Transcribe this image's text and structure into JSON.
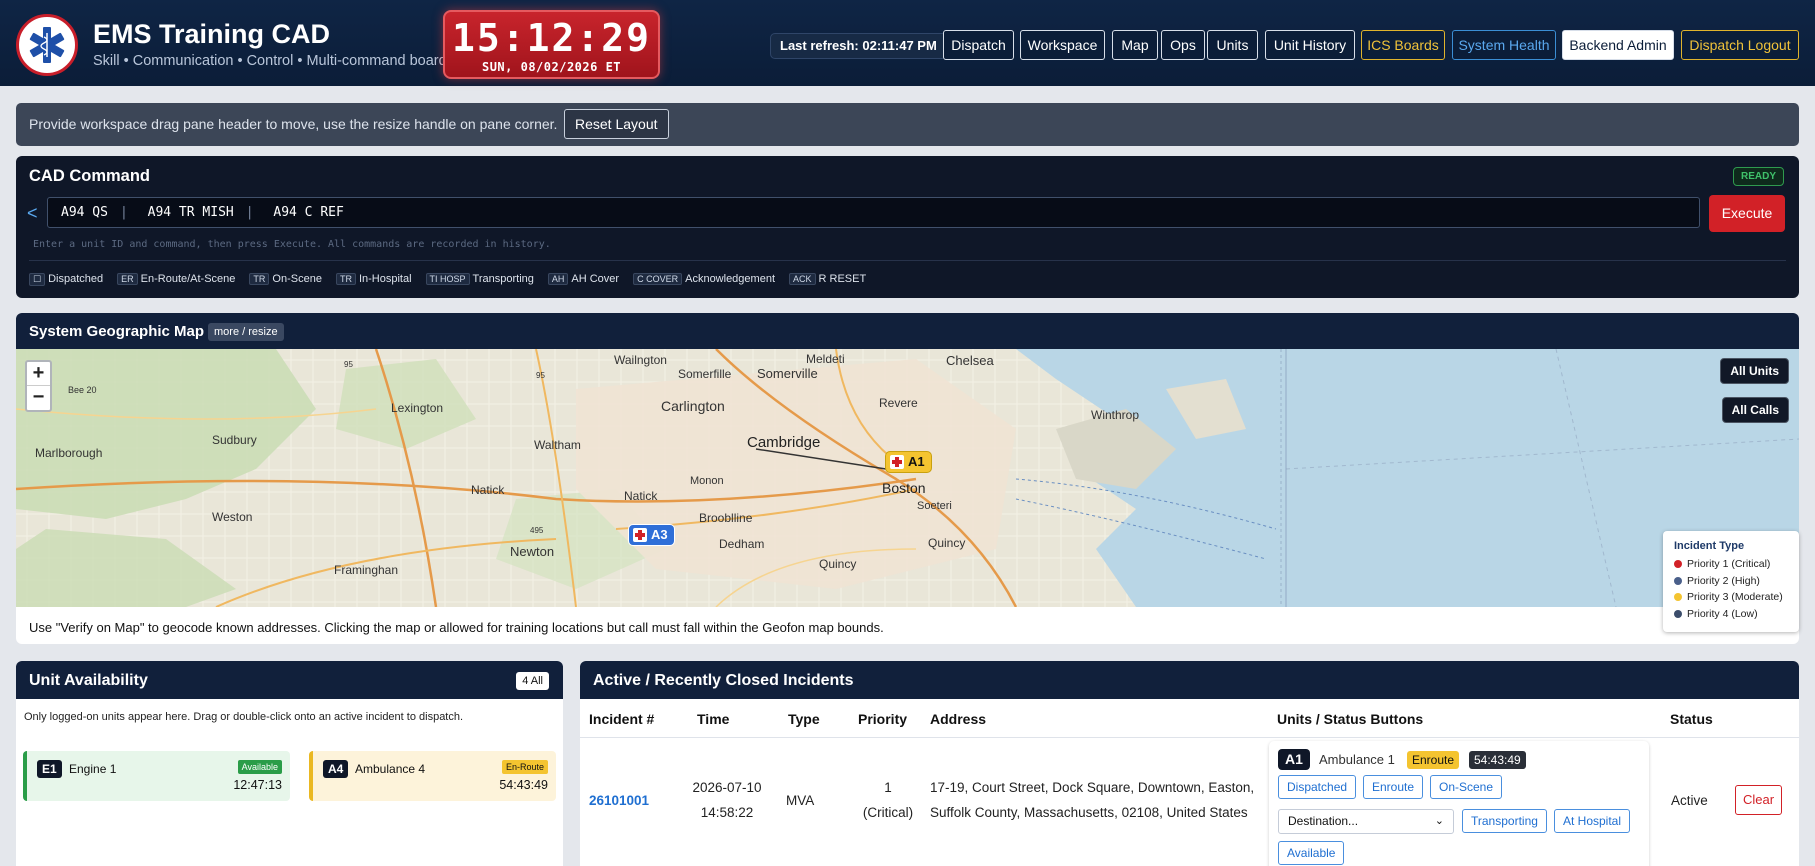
{
  "header": {
    "title": "EMS Training CAD",
    "subtitle": "Skill • Communication • Control • Multi-command board",
    "clock_time": "15:12:29",
    "clock_date": "SUN, 08/02/2026 ET",
    "last_refresh": "Last refresh: 02:11:47 PM",
    "nav": [
      "Dispatch",
      "Workspace",
      "Map",
      "Ops",
      "Units",
      "Unit History",
      "ICS Boards",
      "System Health",
      "Backend Admin",
      "Dispatch Logout"
    ]
  },
  "infobar": {
    "text": "Provide workspace drag pane header to move, use the resize handle on pane corner.",
    "reset_label": "Reset Layout"
  },
  "cad": {
    "title": "CAD Command",
    "ready_badge": "READY",
    "arrow": "<",
    "commands": [
      "A94 QS",
      "A94 TR MISH",
      "A94 C REF"
    ],
    "hint": "Enter a unit ID and command, then press Execute. All commands are recorded in history.",
    "execute_label": "Execute",
    "legend": [
      {
        "code": "☐",
        "label": "Dispatched"
      },
      {
        "code": "ER",
        "label": "En-Route/At-Scene"
      },
      {
        "code": "TR",
        "label": "On-Scene"
      },
      {
        "code": "TR",
        "label": "In-Hospital"
      },
      {
        "code": "TI HOSP",
        "label": "Transporting"
      },
      {
        "code": "AH",
        "label": "AH Cover"
      },
      {
        "code": "C COVER",
        "label": "Acknowledgement"
      },
      {
        "code": "ACK",
        "label": "R RESET"
      }
    ]
  },
  "map": {
    "title": "System Geographic Map",
    "tag": "more / resize",
    "zoom_in": "+",
    "zoom_out": "−",
    "scale_label": "Bee 20",
    "all_units": "All Units",
    "all_calls": "All Calls",
    "units": [
      {
        "id": "A1",
        "color": "#f4c430",
        "text_color": "#111"
      },
      {
        "id": "A3",
        "color": "#2f6fd8",
        "text_color": "#fff"
      }
    ],
    "place_labels": [
      "Wailngton",
      "Somerfille",
      "Somerville",
      "Meldeti",
      "Chelsea",
      "Lexington",
      "Carlington",
      "Revere",
      "Winthrop",
      "Sudbury",
      "Marlborough",
      "Waltham",
      "Cambridge",
      "Monon",
      "Boston",
      "Natick",
      "Natick",
      "Weston",
      "Brooblline",
      "Soeteri",
      "Dedham",
      "Quincy",
      "Quincy",
      "Newton",
      "Framinghan",
      "95",
      "95",
      "495"
    ],
    "legend_title": "Incident Type",
    "legend": [
      {
        "label": "Priority 1 (Critical)",
        "color": "#d22127"
      },
      {
        "label": "Priority 2 (High)",
        "color": "#4a5f8a"
      },
      {
        "label": "Priority 3 (Moderate)",
        "color": "#f4c430"
      },
      {
        "label": "Priority 4 (Low)",
        "color": "#3b4d6b"
      }
    ],
    "footer": "Use \"Verify on Map\" to geocode known addresses. Clicking the map or allowed for training locations but call must fall within the Geofon map bounds."
  },
  "units_panel": {
    "title": "Unit Availability",
    "count": "4 All",
    "note": "Only logged-on units appear here. Drag or double-click onto an active incident to dispatch.",
    "cards": [
      {
        "id": "E1",
        "name": "Engine 1",
        "status": "Available",
        "time": "12:47:13"
      },
      {
        "id": "A4",
        "name": "Ambulance 4",
        "status": "En-Route",
        "time": "54:43:49"
      }
    ]
  },
  "incidents": {
    "title": "Active / Recently Closed Incidents",
    "columns": [
      "Incident #",
      "Time",
      "Type",
      "Priority",
      "Address",
      "Units / Status Buttons",
      "Status"
    ],
    "row": {
      "number": "26101001",
      "date": "2026-07-10",
      "time": "14:58:22",
      "type": "MVA",
      "priority_num": "1",
      "priority_label": "(Critical)",
      "address_1": "17-19, Court Street, Dock Square, Downtown, Easton,",
      "address_2": "Suffolk County, Massachusetts, 02108, United States",
      "unit_id": "A1",
      "unit_name": "Ambulance 1",
      "unit_status": "Enroute",
      "unit_timer": "54:43:49",
      "buttons": [
        "Dispatched",
        "Enroute",
        "On-Scene",
        "Transporting",
        "At Hospital",
        "Available"
      ],
      "destination_placeholder": "Destination...",
      "status": "Active",
      "clear_label": "Clear"
    }
  }
}
